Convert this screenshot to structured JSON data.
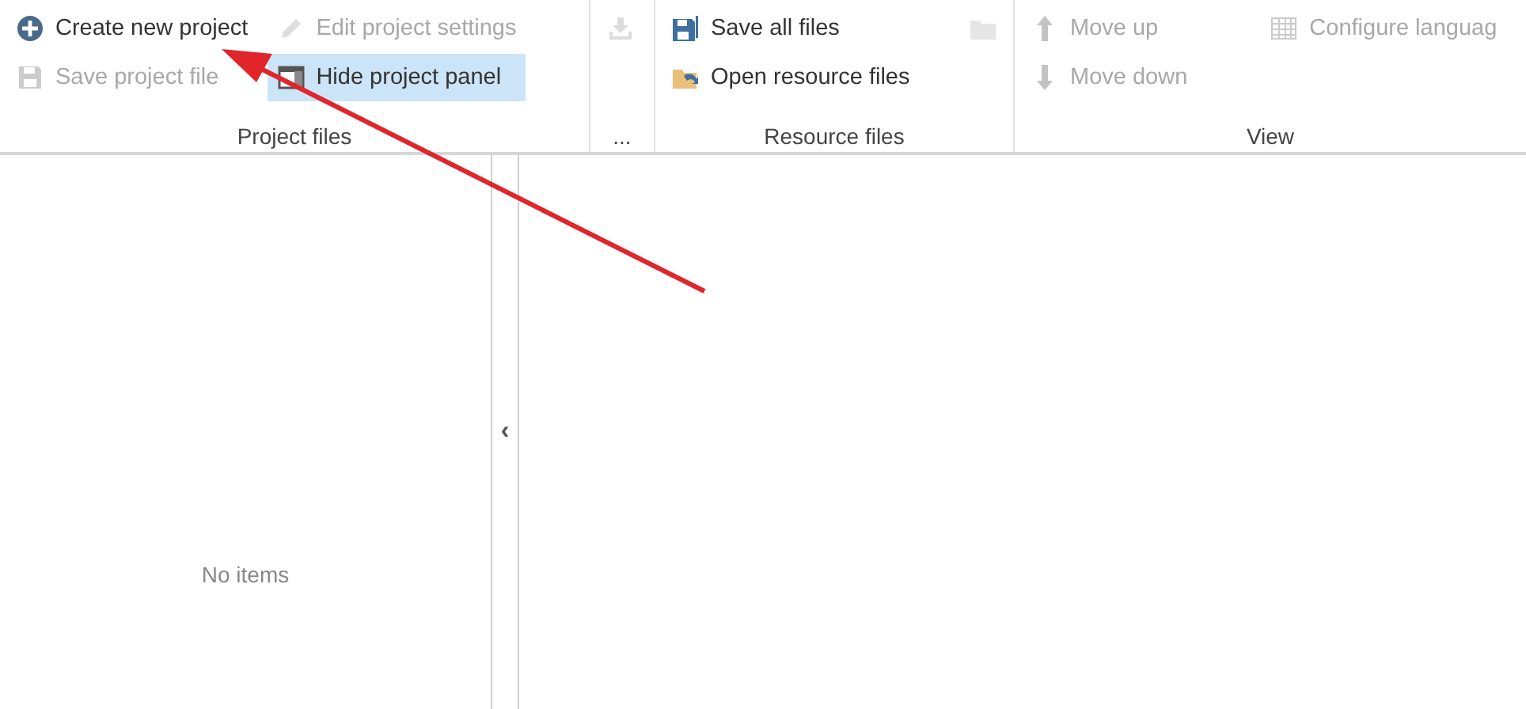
{
  "ribbon": {
    "groups": [
      {
        "label": "Project files",
        "columns": [
          [
            {
              "label": "Create new project",
              "disabled": false,
              "selected": false
            },
            {
              "label": "Save project file",
              "disabled": true,
              "selected": false
            }
          ],
          [
            {
              "label": "Edit project settings",
              "disabled": true,
              "selected": false
            },
            {
              "label": "Hide project panel",
              "disabled": false,
              "selected": true
            }
          ]
        ]
      },
      {
        "label": "...",
        "columns": [
          [
            {
              "disabled": true,
              "selected": false
            }
          ]
        ]
      },
      {
        "label": "Resource files",
        "columns": [
          [
            {
              "label": "Save all files",
              "disabled": false,
              "selected": false
            },
            {
              "label": "Open resource files",
              "disabled": false,
              "selected": false
            }
          ],
          [
            {
              "disabled": true,
              "selected": false
            }
          ]
        ]
      },
      {
        "label": "View",
        "columns": [
          [
            {
              "label": "Move up",
              "disabled": true,
              "selected": false
            },
            {
              "label": "Move down",
              "disabled": true,
              "selected": false
            }
          ],
          [
            {
              "label": "Configure languag",
              "disabled": true,
              "selected": false
            }
          ]
        ]
      }
    ]
  },
  "project_panel": {
    "empty_text": "No items",
    "collapse": "‹"
  }
}
